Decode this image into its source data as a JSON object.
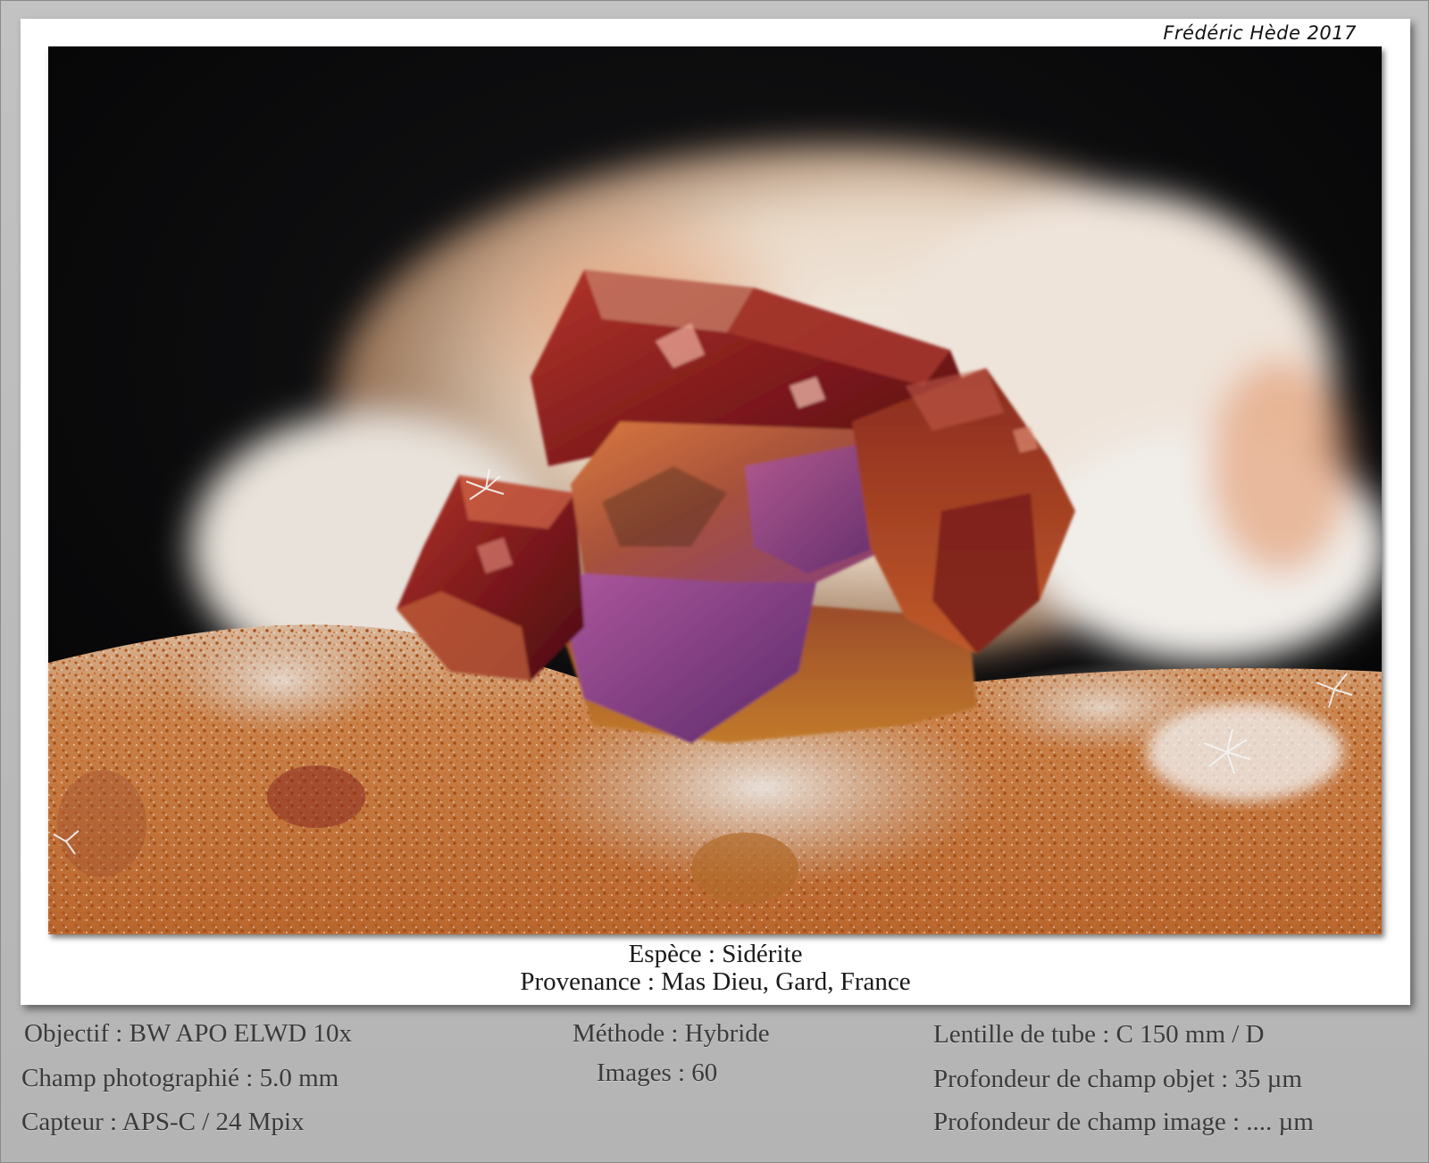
{
  "credit": "Frédéric Hède 2017",
  "caption": {
    "species": "Espèce : Sidérite",
    "origin": "Provenance : Mas Dieu, Gard, France"
  },
  "metadata": {
    "left": [
      "Objectif : BW APO ELWD 10x",
      "Champ photographié : 5.0 mm",
      "Capteur : APS-C / 24 Mpix"
    ],
    "center": [
      "Méthode : Hybride",
      "Images : 60"
    ],
    "right": [
      "Lentille de tube : C 150 mm / D",
      "Profondeur de champ objet : 35 µm",
      "Profondeur de champ image : .... µm"
    ]
  },
  "colors": {
    "background_gray": "#b8b8b8",
    "card": "#ffffff",
    "photo_backdrop": "#0a0a0c",
    "crystal_red": "#8a1e1a",
    "crystal_violet": "#7a3a78",
    "matrix_orange": "#c4702c",
    "matrix_white": "#e8e4de"
  }
}
